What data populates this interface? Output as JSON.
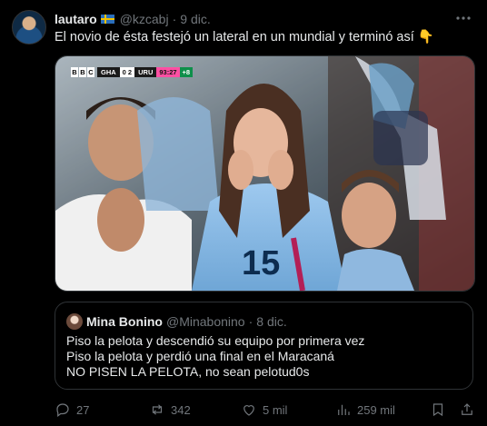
{
  "author": {
    "name": "lautaro",
    "handle": "@kzcabj",
    "separator": "·",
    "date": "9 dic."
  },
  "tweet": {
    "text": "El novio de ésta festejó un lateral en un mundial y terminó así 👇"
  },
  "scoreboard": {
    "broadcaster": [
      "B",
      "B",
      "C"
    ],
    "home": "GHA",
    "score": "0 2",
    "away": "URU",
    "time": "93:27",
    "added": "+8"
  },
  "quoted": {
    "name": "Mina Bonino",
    "handle": "@Minabonino",
    "separator": "·",
    "date": "8 dic.",
    "lines": [
      "Piso la pelota y descendió su equipo por primera vez",
      "Piso la pelota y perdió una final en el Maracaná",
      "NO PISEN LA PELOTA, no sean pelotud0s"
    ]
  },
  "actions": {
    "replies": "27",
    "reposts": "342",
    "likes": "5 mil",
    "views": "259 mil"
  },
  "icons": [
    "verified-flag-icon",
    "more-icon",
    "reply-icon",
    "repost-icon",
    "like-icon",
    "views-icon",
    "bookmark-icon",
    "share-icon"
  ],
  "colors": {
    "background": "#000000",
    "text": "#e7e9ea",
    "muted": "#71767b",
    "border": "#2f3336"
  }
}
